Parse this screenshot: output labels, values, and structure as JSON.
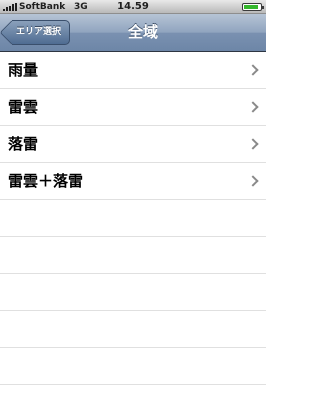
{
  "status_bar": {
    "carrier": "SoftBank",
    "network": "3G",
    "time": "14.59",
    "battery_level": 0.9
  },
  "nav": {
    "back_label": "エリア選択",
    "title": "全域"
  },
  "rows": [
    {
      "label": "雨量"
    },
    {
      "label": "雷雲"
    },
    {
      "label": "落雷"
    },
    {
      "label": "雷雲＋落雷"
    }
  ],
  "empty_rows": 5
}
